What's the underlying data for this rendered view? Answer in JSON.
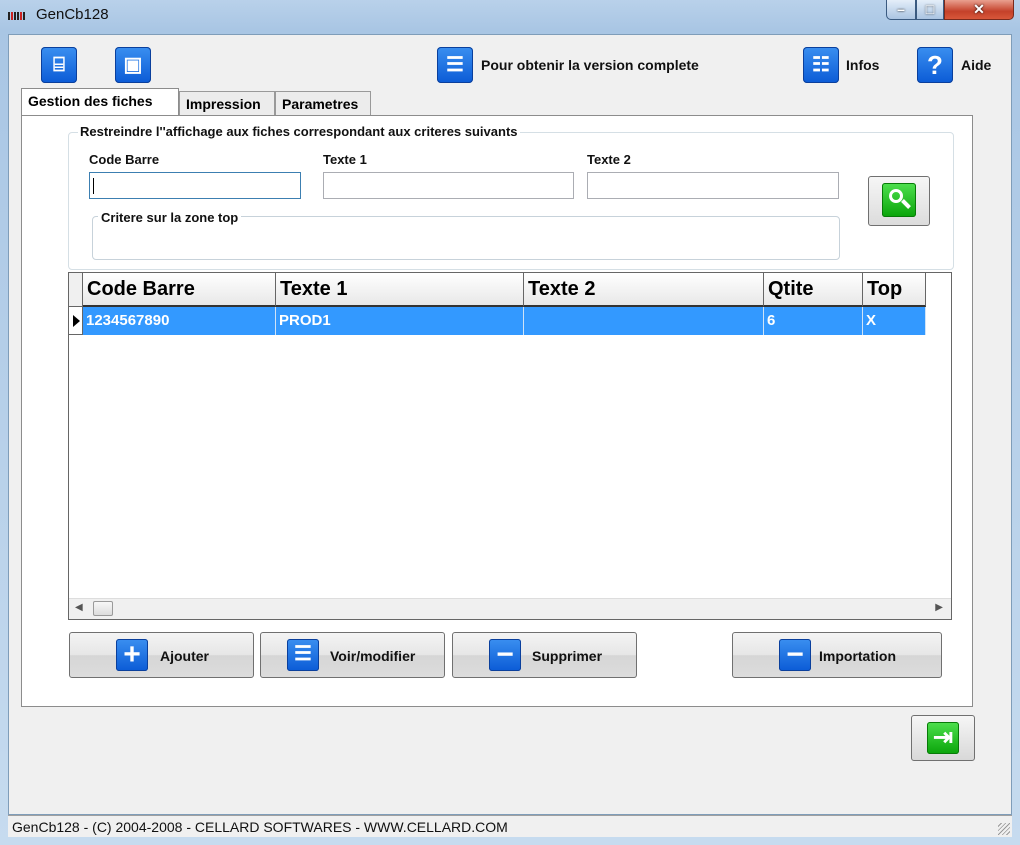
{
  "window": {
    "title": "GenCb128"
  },
  "toolbar": {
    "version_label": "Pour obtenir la version complete",
    "infos_label": "Infos",
    "aide_label": "Aide",
    "aide_glyph": "?",
    "icons": [
      "open-folder-icon",
      "save-icon",
      "upgrade-icon",
      "infos-icon",
      "help-icon"
    ]
  },
  "tabs": [
    {
      "label": "Gestion des fiches",
      "active": true
    },
    {
      "label": "Impression",
      "active": false
    },
    {
      "label": "Parametres",
      "active": false
    }
  ],
  "filter": {
    "group_title": "Restreindre l''affichage aux fiches correspondant aux criteres suivants",
    "code_barre_label": "Code Barre",
    "texte1_label": "Texte 1",
    "texte2_label": "Texte 2",
    "code_barre_value": "",
    "texte1_value": "",
    "texte2_value": "",
    "zone_top_title": "Critere sur la zone top"
  },
  "grid": {
    "columns": [
      "Code Barre",
      "Texte 1",
      "Texte 2",
      "Qtite",
      "Top"
    ],
    "rows": [
      {
        "code_barre": "1234567890",
        "texte1": "PROD1",
        "texte2": "",
        "qtite": "6",
        "top": "X",
        "selected": true
      }
    ]
  },
  "actions": {
    "ajouter": "Ajouter",
    "voir_modifier": "Voir/modifier",
    "supprimer": "Supprimer",
    "importation": "Importation"
  },
  "statusbar": {
    "text": "GenCb128 - (C) 2004-2008 - CELLARD SOFTWARES - WWW.CELLARD.COM"
  },
  "colors": {
    "selection": "#3399ff",
    "accent_blue": "#0b5bd6",
    "accent_green": "#0aa40a"
  }
}
